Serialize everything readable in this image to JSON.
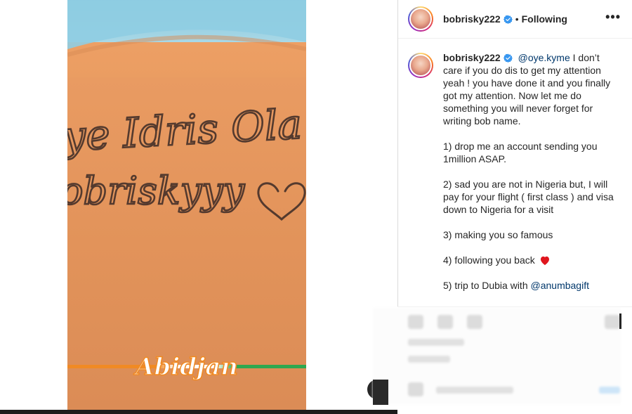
{
  "media": {
    "overlay_text": "Abidjan",
    "tattoo_line1": "ye Idris Ola",
    "tattoo_line2": "obriskyyy"
  },
  "header": {
    "username": "bobrisky222",
    "separator": "•",
    "follow_status": "Following",
    "more_icon": "more-horizontal-icon"
  },
  "caption": {
    "username": "bobrisky222",
    "mention": "@oye.kyme",
    "intro": " I don’t care if you do dis to get my attention yeah ! you have done it and you finally got my attention. Now let me do something you will never forget for writing bob name.",
    "item1": "1) drop me an account sending you 1million ASAP.",
    "item2": "2) sad you are not in Nigeria but, I will pay for your flight ( first class ) and visa down to Nigeria for a visit",
    "item3": "3) making you so famous",
    "item4": "4) following you back ",
    "item5_prefix": "5) trip to Dubia with ",
    "item5_mention": "@anumbagift"
  },
  "colors": {
    "verified": "#3897f0",
    "heart": "#e0161e",
    "mention": "#00376b",
    "ribbon_orange": "#f08a24",
    "ribbon_green": "#2fa84f"
  }
}
